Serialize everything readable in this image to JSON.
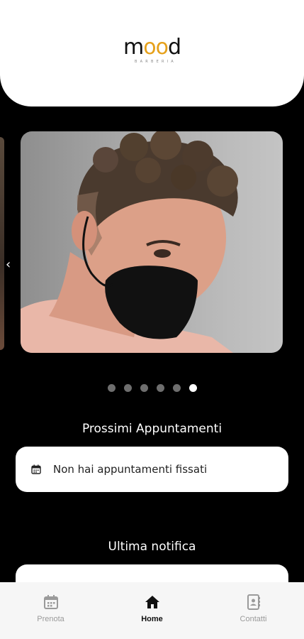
{
  "brand": {
    "name_part1": "m",
    "name_part2": "oo",
    "name_part3": "d",
    "subtitle": "BARBERIA"
  },
  "carousel": {
    "prev_arrow": "‹",
    "dots_count": 6,
    "active_dot": 5,
    "slide_image": "man-curly-hair-black-mask-photo"
  },
  "appointments": {
    "title": "Prossimi Appuntamenti",
    "empty_text": "Non hai appuntamenti fissati",
    "icon": "calendar-icon"
  },
  "notifications": {
    "title": "Ultima notifica"
  },
  "bottom_nav": {
    "items": [
      {
        "label": "Prenota",
        "icon": "calendar-icon",
        "active": false
      },
      {
        "label": "Home",
        "icon": "home-icon",
        "active": true
      },
      {
        "label": "Contatti",
        "icon": "contacts-icon",
        "active": false
      }
    ]
  },
  "colors": {
    "background": "#000000",
    "accent_gold": "#e6a11b",
    "nav_active": "#111111",
    "nav_inactive": "#9a9a9a"
  }
}
